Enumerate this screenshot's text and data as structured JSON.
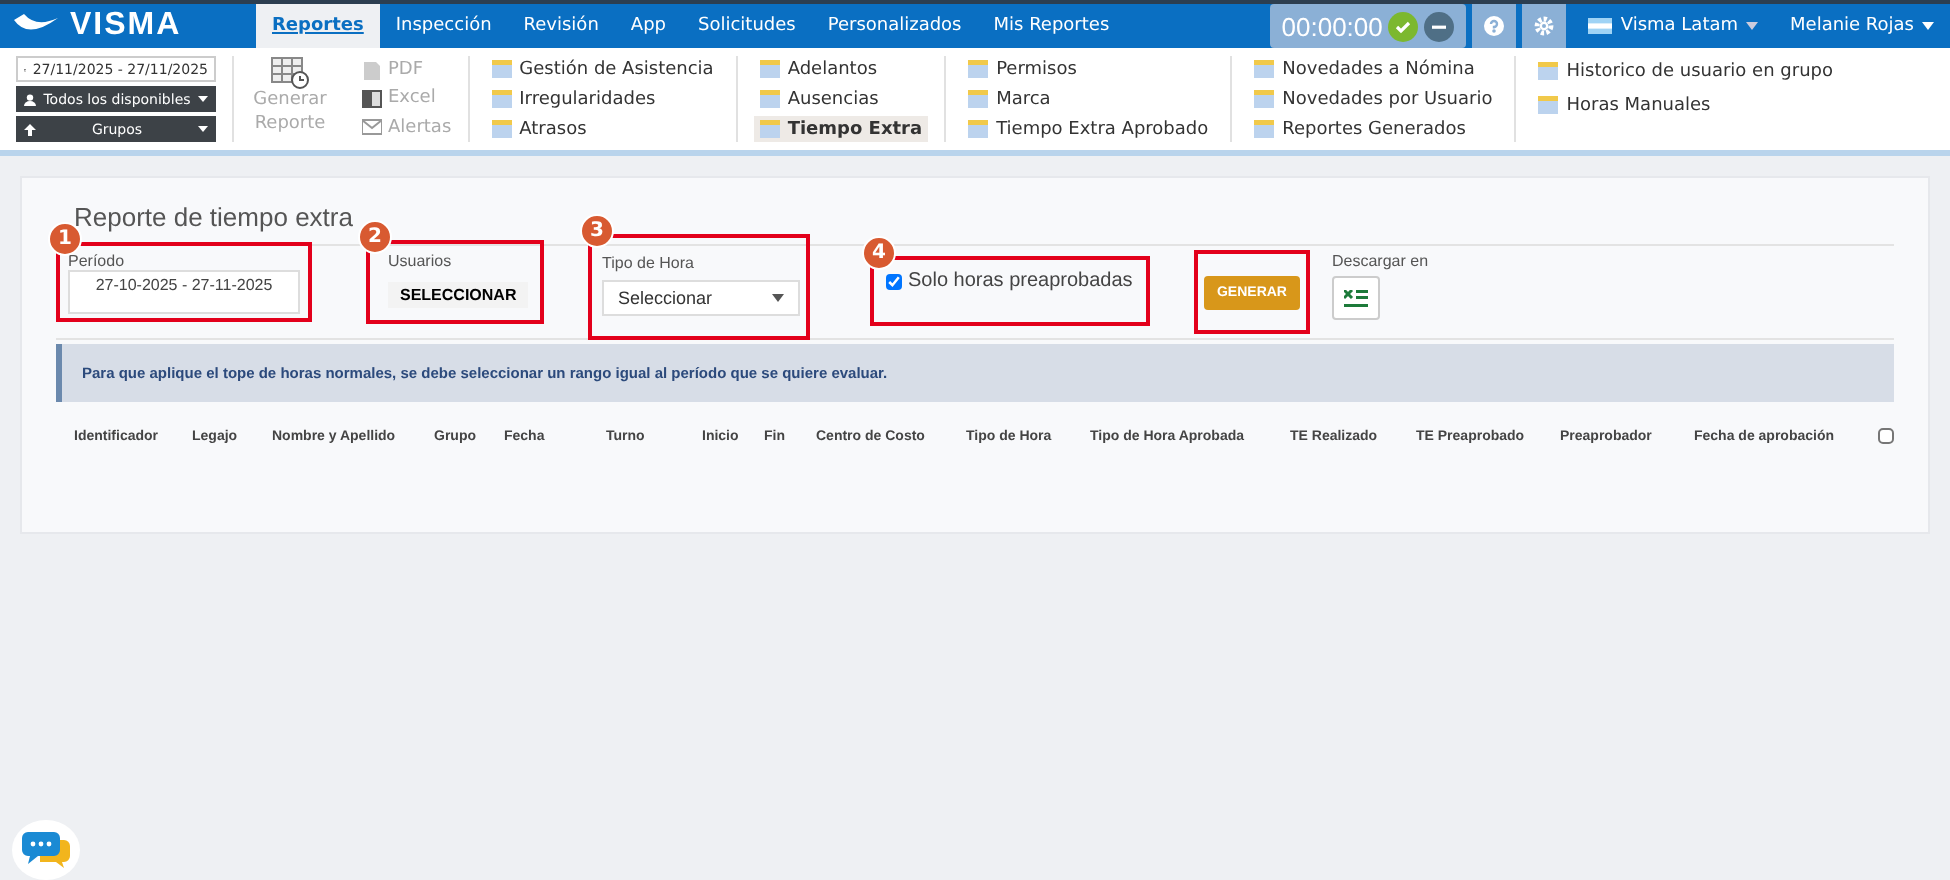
{
  "top_bar": {
    "logo": "VISMA",
    "tabs": [
      {
        "label": "Reportes",
        "selected": true
      },
      {
        "label": "Inspección",
        "selected": false
      },
      {
        "label": "Revisión",
        "selected": false
      },
      {
        "label": "App",
        "selected": false
      },
      {
        "label": "Solicitudes",
        "selected": false
      },
      {
        "label": "Personalizados",
        "selected": false
      },
      {
        "label": "Mis Reportes",
        "selected": false
      }
    ],
    "timer": "00:00:00",
    "company": "Visma Latam",
    "user": "Melanie Rojas"
  },
  "ribbon": {
    "date_range": "27/11/2025 - 27/11/2025",
    "dropdowns": [
      "Todos los disponibles",
      "Grupos"
    ],
    "generate": {
      "label": "Generar Reporte",
      "disabled": true
    },
    "exports": [
      {
        "kind": "pdf",
        "label": "PDF",
        "disabled": true
      },
      {
        "kind": "excel",
        "label": "Excel",
        "disabled": true
      },
      {
        "kind": "mail",
        "label": "Alertas",
        "disabled": true
      }
    ],
    "menu_columns": [
      [
        {
          "label": "Gestión de Asistencia",
          "selected": false
        },
        {
          "label": "Irregularidades",
          "selected": false
        },
        {
          "label": "Atrasos",
          "selected": false
        }
      ],
      [
        {
          "label": "Adelantos",
          "selected": false
        },
        {
          "label": "Ausencias",
          "selected": false
        },
        {
          "label": "Tiempo Extra",
          "selected": true
        }
      ],
      [
        {
          "label": "Permisos",
          "selected": false
        },
        {
          "label": "Marca",
          "selected": false
        },
        {
          "label": "Tiempo Extra Aprobado",
          "selected": false
        }
      ],
      [
        {
          "label": "Novedades a Nómina",
          "selected": false
        },
        {
          "label": "Novedades por Usuario",
          "selected": false
        },
        {
          "label": "Reportes Generados",
          "selected": false
        }
      ],
      [
        {
          "label": "Historico de usuario en grupo",
          "selected": false
        },
        {
          "label": "Horas Manuales",
          "selected": false
        }
      ]
    ]
  },
  "report": {
    "title": "Reporte de tiempo extra",
    "periodo": {
      "callout": "1",
      "label": "Período",
      "value": "27-10-2025 - 27-11-2025"
    },
    "usuarios": {
      "callout": "2",
      "label": "Usuarios",
      "button": "SELECCIONAR"
    },
    "tipo_de_hora": {
      "callout": "3",
      "label": "Tipo de Hora",
      "value": "Seleccionar"
    },
    "solo_preaprobadas": {
      "callout": "4",
      "label": "Solo horas preaprobadas",
      "checked": true
    },
    "generar": {
      "label": "GENERAR"
    },
    "descargar": {
      "label": "Descargar en"
    },
    "notice": "Para que aplique el tope de horas normales, se debe seleccionar un rango igual al período que se quiere evaluar.",
    "table": {
      "columns": [
        "Identificador",
        "Legajo",
        "Nombre y Apellido",
        "Grupo",
        "Fecha",
        "Turno",
        "Inicio",
        "Fin",
        "Centro de Costo",
        "Tipo de Hora",
        "Tipo de Hora Aprobada",
        "TE Realizado",
        "TE Preaprobado",
        "Preaprobador",
        "Fecha de aprobación"
      ],
      "select_all_checked": false
    }
  }
}
